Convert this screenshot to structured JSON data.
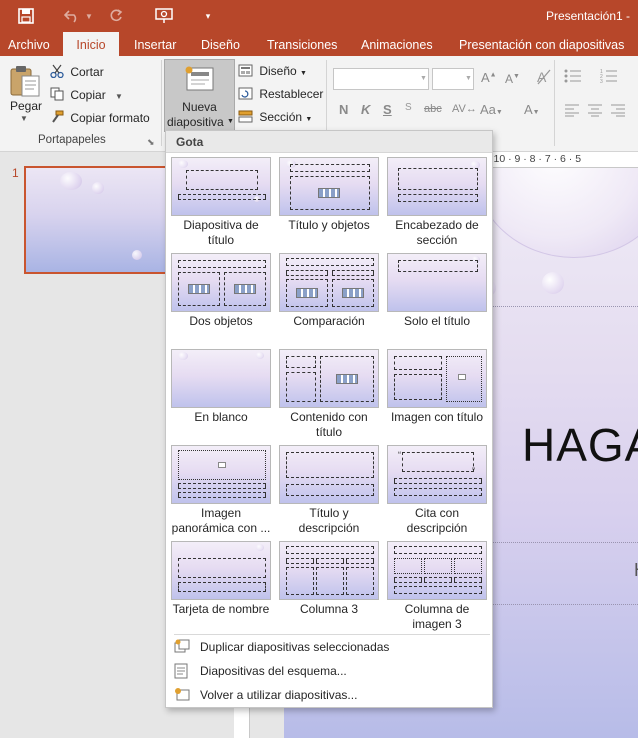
{
  "app": {
    "doc_title": "Presentación1 - "
  },
  "tabs": [
    "Archivo",
    "Inicio",
    "Insertar",
    "Diseño",
    "Transiciones",
    "Animaciones",
    "Presentación con diapositivas"
  ],
  "ribbon": {
    "paste_label": "Pegar",
    "cut_label": "Cortar",
    "copy_label": "Copiar",
    "format_painter_label": "Copiar formato",
    "clipboard_group": "Portapapeles",
    "new_slide_line1": "Nueva",
    "new_slide_line2": "diapositiva",
    "layout_label": "Diseño",
    "reset_label": "Restablecer",
    "section_label": "Sección",
    "font_buttons": [
      "N",
      "K",
      "S",
      "abc"
    ]
  },
  "thumbnail_pane": {
    "slide_number": "1"
  },
  "ruler": {
    "ticks": "·10 · 9 · 8 · 7 · 6 · 5"
  },
  "slide": {
    "title": "HAGA",
    "subtitle": "H"
  },
  "layout_gallery": {
    "theme_name": "Gota",
    "layouts": [
      {
        "name": "Diapositiva de título"
      },
      {
        "name": "Título y objetos"
      },
      {
        "name": "Encabezado de sección"
      },
      {
        "name": "Dos objetos"
      },
      {
        "name": "Comparación"
      },
      {
        "name": "Solo el título"
      },
      {
        "name": "En blanco"
      },
      {
        "name": "Contenido con título"
      },
      {
        "name": "Imagen con título"
      },
      {
        "name": "Imagen panorámica con ..."
      },
      {
        "name": "Título y descripción"
      },
      {
        "name": "Cita con descripción"
      },
      {
        "name": "Tarjeta de nombre"
      },
      {
        "name": "Columna 3"
      },
      {
        "name": "Columna de imagen 3"
      }
    ],
    "commands": [
      {
        "label": "Duplicar diapositivas seleccionadas"
      },
      {
        "label": "Diapositivas del esquema..."
      },
      {
        "label": "Volver a utilizar diapositivas..."
      }
    ]
  },
  "colors": {
    "accent": "#b7472a",
    "ribbon_bg": "#f3f3f3",
    "menu_bg": "#ffffff"
  }
}
